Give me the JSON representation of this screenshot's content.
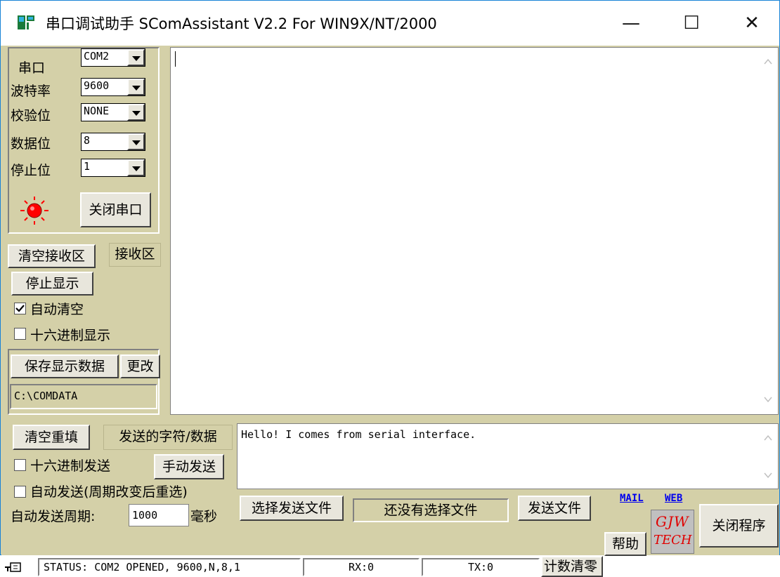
{
  "window": {
    "title": "串口调试助手 SComAssistant V2.2 For WIN9X/NT/2000",
    "minimize_glyph": "—",
    "maximize_glyph": "☐",
    "close_glyph": "✕"
  },
  "port_settings": {
    "port_label": "串口",
    "port_value": "COM2",
    "baud_label": "波特率",
    "baud_value": "9600",
    "parity_label": "校验位",
    "parity_value": "NONE",
    "databits_label": "数据位",
    "databits_value": "8",
    "stopbits_label": "停止位",
    "stopbits_value": "1",
    "close_port_button": "关闭串口",
    "indicator_color": "#ff0000"
  },
  "receive": {
    "clear_button": "清空接收区",
    "area_label": "接收区",
    "stop_display_button": "停止显示",
    "auto_clear_label": "自动清空",
    "auto_clear_checked": true,
    "hex_display_label": "十六进制显示",
    "hex_display_checked": false,
    "save_button": "保存显示数据",
    "change_button": "更改",
    "save_path": "C:\\COMDATA",
    "text": ""
  },
  "send": {
    "clear_refill_button": "清空重填",
    "area_label": "发送的字符/数据",
    "hex_send_label": "十六进制发送",
    "hex_send_checked": false,
    "manual_send_button": "手动发送",
    "auto_send_label": "自动发送(周期改变后重选)",
    "auto_send_checked": false,
    "period_label": "自动发送周期:",
    "period_value": "1000",
    "period_unit": "毫秒",
    "text": "Hello! I comes from serial interface.",
    "choose_file_button": "选择发送文件",
    "file_status": "还没有选择文件",
    "send_file_button": "发送文件"
  },
  "links": {
    "mail": "MAIL",
    "web": "WEB"
  },
  "footer": {
    "close_program_button": "关闭程序",
    "help_button": "帮助",
    "logo_line1": "GJW",
    "logo_line2": "TECH",
    "status": "STATUS: COM2 OPENED, 9600,N,8,1",
    "rx": "RX:0",
    "tx": "TX:0",
    "count_clear_button": "计数清零"
  }
}
